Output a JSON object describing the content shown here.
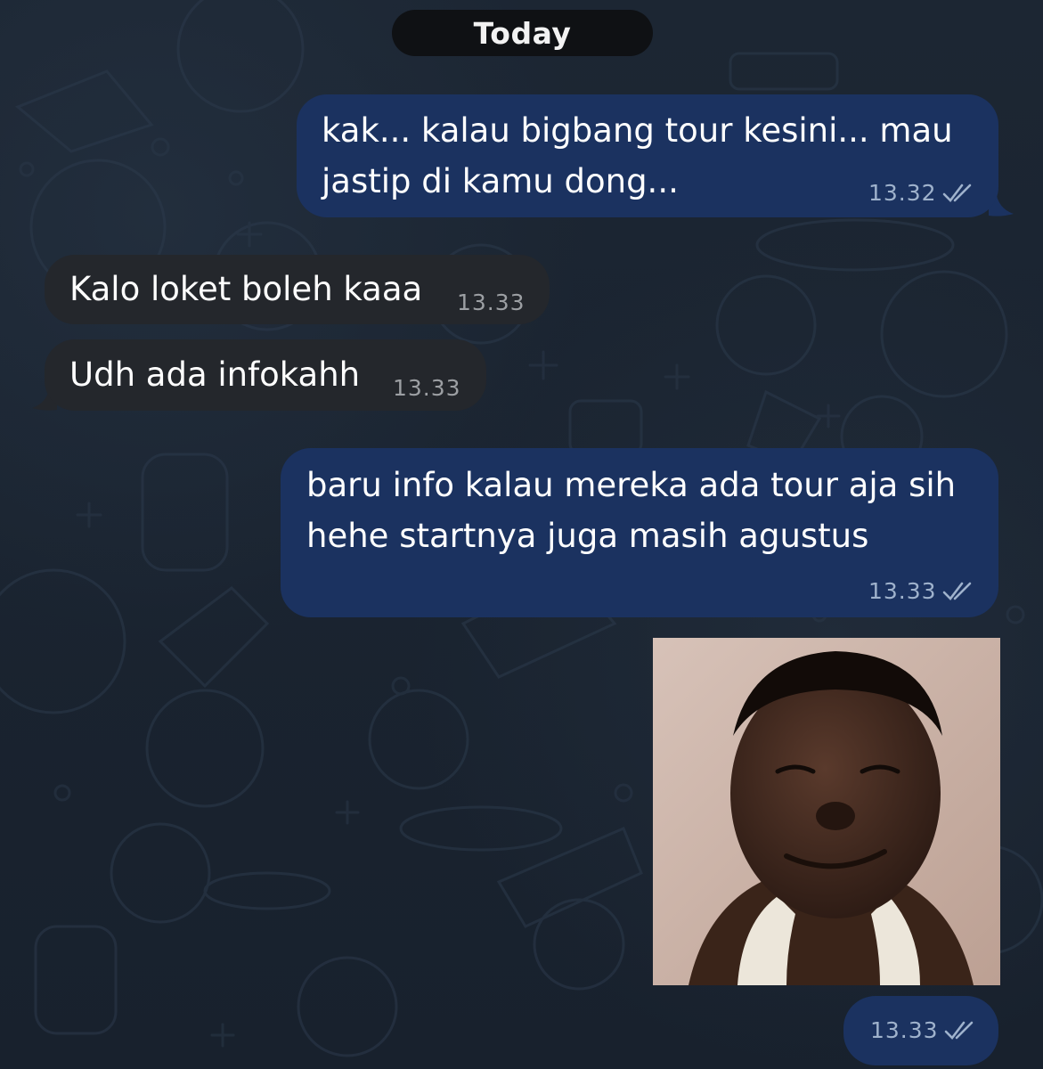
{
  "chat": {
    "date_label": "Today",
    "messages": [
      {
        "direction": "outgoing",
        "text": "kak... kalau bigbang tour kesini... mau\njastip di kamu dong...",
        "time": "13.32",
        "read_icon": "double-check-icon"
      },
      {
        "direction": "incoming",
        "text": "Kalo loket boleh kaaa",
        "time": "13.33"
      },
      {
        "direction": "incoming",
        "text": "Udh ada infokahh",
        "time": "13.33"
      },
      {
        "direction": "outgoing",
        "text": "baru info kalau mereka ada tour aja sih\nhehe startnya juga masih agustus",
        "time": "13.33",
        "read_icon": "double-check-icon"
      },
      {
        "direction": "outgoing",
        "type": "sticker",
        "sticker": "smiling-boy-meme-sticker",
        "time": "13.33",
        "read_icon": "double-check-icon"
      }
    ]
  },
  "colors": {
    "background": "#1a2431",
    "outgoing_bubble": "#1b3260",
    "incoming_bubble": "#24272c",
    "date_pill": "#0f1114",
    "meta_out": "#9fb2cc",
    "meta_in": "#9c9fa3"
  }
}
